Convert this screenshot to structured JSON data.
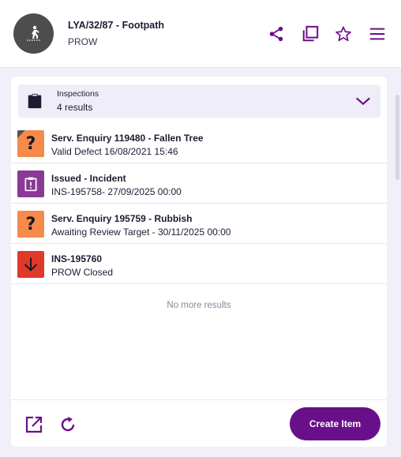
{
  "header": {
    "title": "LYA/32/87 - Footpath",
    "subtitle": "PROW",
    "avatar_icon": "pedestrian-walking-icon",
    "actions": [
      "share-icon",
      "copy-icon",
      "star-icon",
      "menu-icon"
    ],
    "accent_color": "#6a0f8a"
  },
  "group": {
    "label": "Inspections",
    "count": "4 results",
    "icon": "clipboard-icon",
    "expanded": true
  },
  "items": [
    {
      "title": "Serv. Enquiry 119480 - Fallen Tree",
      "subtitle": "Valid Defect 16/08/2021 15:46",
      "icon": "question-mark-icon",
      "color": "#f58a4b"
    },
    {
      "title": "Issued - Incident",
      "subtitle": "INS-195758-  27/09/2025 00:00",
      "icon": "clipboard-alert-icon",
      "color": "#8a3a96"
    },
    {
      "title": "Serv. Enquiry 195759 - Rubbish",
      "subtitle": "Awaiting Review Target - 30/11/2025 00:00",
      "icon": "question-mark-icon",
      "color": "#f58a4b"
    },
    {
      "title": "INS-195760",
      "subtitle": "PROW Closed",
      "icon": "arrow-down-icon",
      "color": "#e0392b"
    }
  ],
  "no_more_text": "No more results",
  "footer": {
    "create_label": "Create Item",
    "icons": [
      "open-external-icon",
      "refresh-icon"
    ]
  }
}
